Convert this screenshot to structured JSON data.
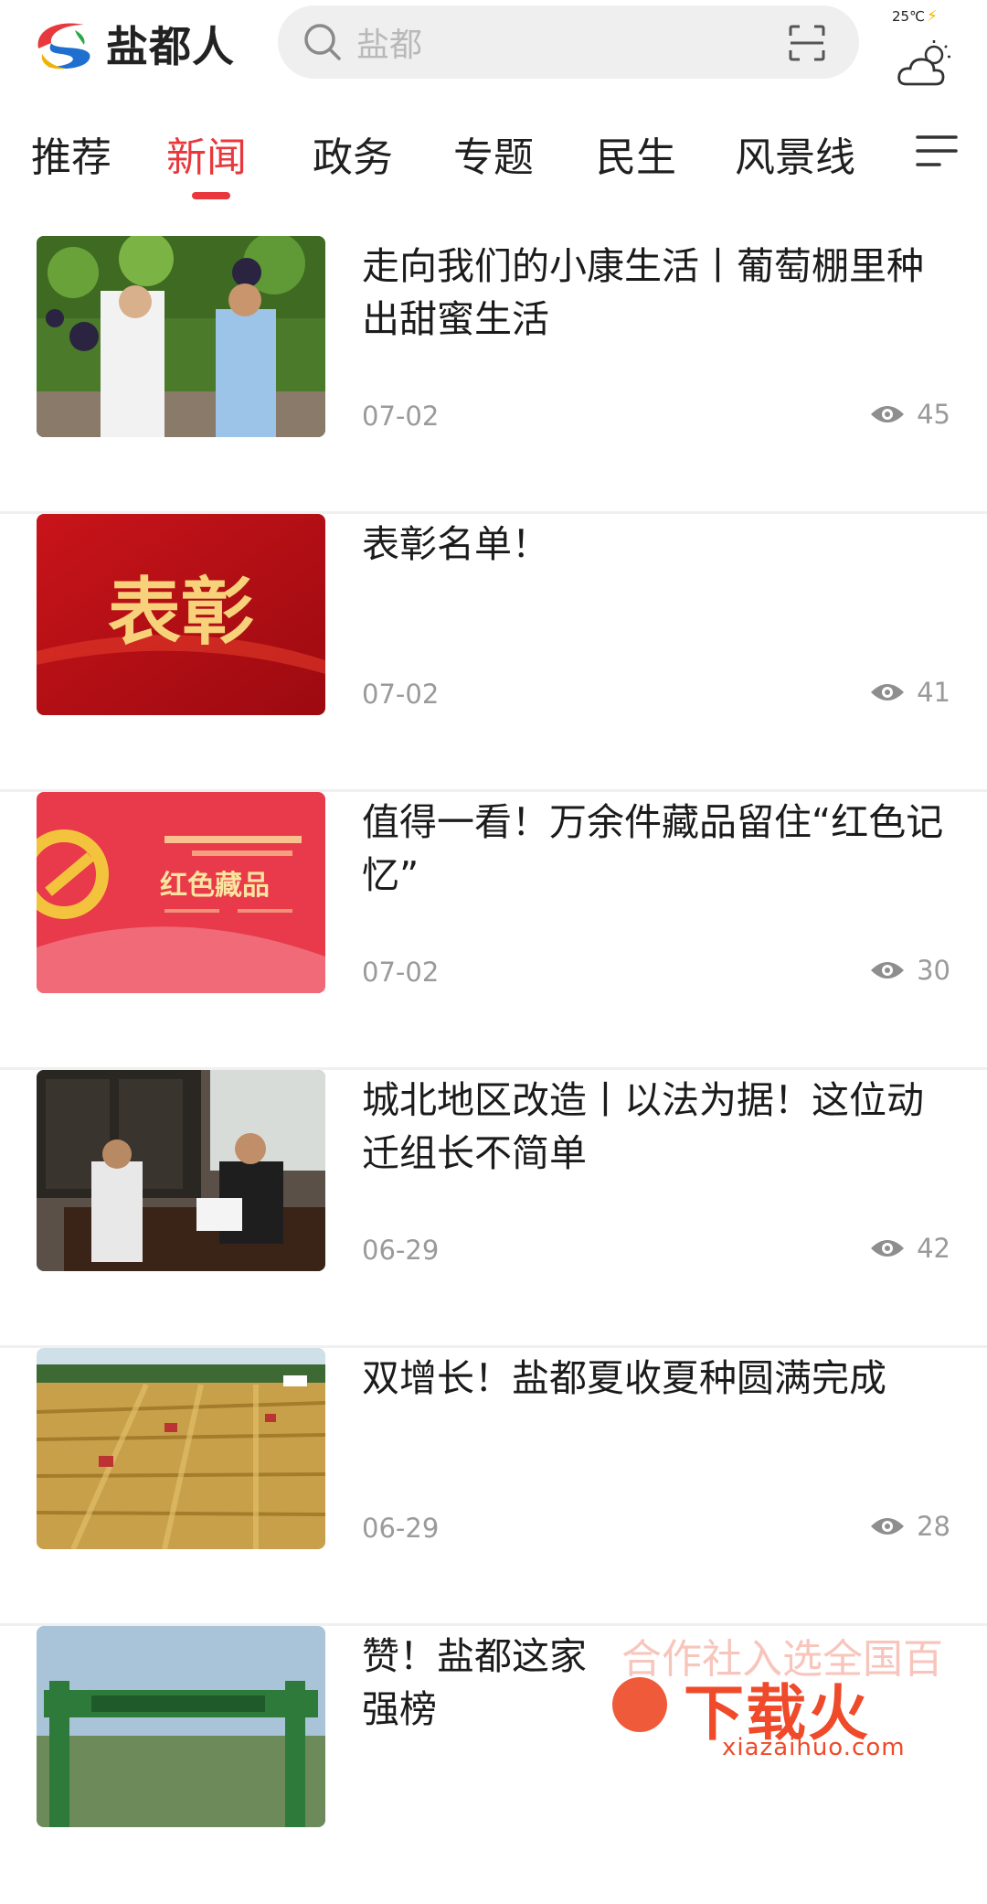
{
  "header": {
    "app_name": "盐都人",
    "search_placeholder": "盐都",
    "temperature": "25℃",
    "weather_icon": "partly-cloudy-icon"
  },
  "tabs": [
    {
      "label": "推荐",
      "active": false
    },
    {
      "label": "新闻",
      "active": true
    },
    {
      "label": "政务",
      "active": false
    },
    {
      "label": "专题",
      "active": false
    },
    {
      "label": "民生",
      "active": false
    },
    {
      "label": "风景线",
      "active": false
    }
  ],
  "articles": [
    {
      "title": "走向我们的小康生活丨葡萄棚里种出甜蜜生活",
      "date": "07-02",
      "views": "45"
    },
    {
      "title": "表彰名单！",
      "date": "07-02",
      "views": "41",
      "thumb_text": "表彰"
    },
    {
      "title": "值得一看！万余件藏品留住“红色记忆”",
      "date": "07-02",
      "views": "30",
      "thumb_text": "红色藏品"
    },
    {
      "title": "城北地区改造丨以法为据！这位动迁组长不简单",
      "date": "06-29",
      "views": "42"
    },
    {
      "title": "双增长！盐都夏收夏种圆满完成",
      "date": "06-29",
      "views": "28"
    },
    {
      "title": "赞！盐都这家",
      "title_line2": "强榜",
      "date": "",
      "views": ""
    }
  ],
  "watermark": {
    "top_text": "合作社入选全国百",
    "brand": "下载火",
    "url": "xiazaihuo.com"
  },
  "colors": {
    "accent": "#e8383d",
    "meta_text": "#9a9a9a"
  }
}
